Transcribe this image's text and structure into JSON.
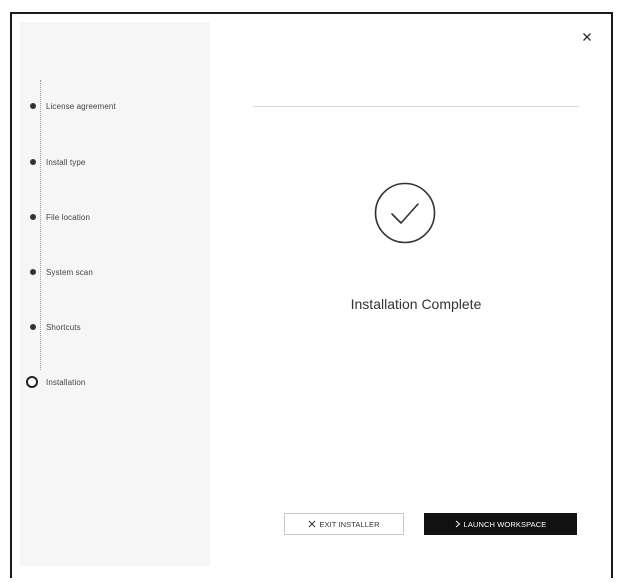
{
  "window": {
    "close_label": "×"
  },
  "sidebar": {
    "steps": [
      {
        "label": "License agreement",
        "state": "done"
      },
      {
        "label": "Install type",
        "state": "done"
      },
      {
        "label": "File location",
        "state": "done"
      },
      {
        "label": "System scan",
        "state": "done"
      },
      {
        "label": "Shortcuts",
        "state": "done"
      },
      {
        "label": "Installation",
        "state": "current"
      }
    ]
  },
  "main": {
    "status_title": "Installation Complete",
    "status_icon": "checkmark-circle-icon"
  },
  "footer": {
    "exit_label": "EXIT INSTALLER",
    "exit_icon": "x-icon",
    "launch_label": "LAUNCH WORKSPACE",
    "launch_icon": "chevron-right-icon"
  },
  "colors": {
    "text": "#333333",
    "sidebar_bg": "#f6f6f6",
    "primary_button": "#111111",
    "border": "#1a1a1a"
  }
}
